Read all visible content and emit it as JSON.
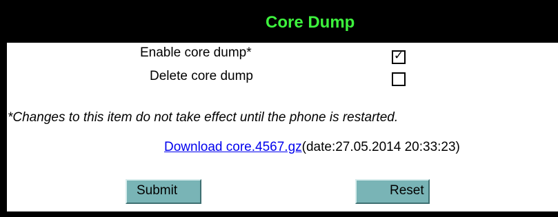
{
  "header": {
    "title": "Core Dump"
  },
  "settings": {
    "enable_core_dump": {
      "label": "Enable core dump*",
      "checked": true
    },
    "delete_core_dump": {
      "label": "Delete core dump",
      "checked": false
    }
  },
  "note": "*Changes to this item do not take effect until the phone is restarted.",
  "download": {
    "link_text": "Download core.4567.gz",
    "date_text": "(date:27.05.2014 20:33:23)"
  },
  "buttons": {
    "submit_label": "Submit",
    "reset_label": "Reset"
  },
  "colors": {
    "title_text": "#3df23d",
    "header_background": "#000000",
    "button_background": "#79b4b6",
    "link": "#0000ee"
  }
}
